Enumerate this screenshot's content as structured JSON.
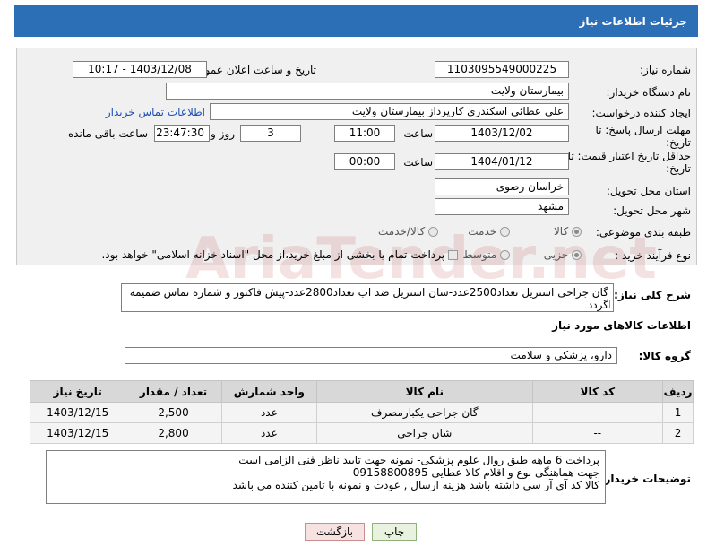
{
  "title": "جزئیات اطلاعات نیاز",
  "fields": {
    "need_number_label": "شماره نیاز:",
    "need_number": "1103095549000225",
    "announce_label": "تاریخ و ساعت اعلان عمومی:",
    "announce_value": "1403/12/08 - 10:17",
    "buyer_org_label": "نام دستگاه خریدار:",
    "buyer_org": "بیمارستان ولایت",
    "requester_label": "ایجاد کننده درخواست:",
    "requester": "علی عطائی اسکندری کارپرداز بیمارستان ولایت",
    "contact_link": "اطلاعات تماس خریدار",
    "deadline_label_1": "مهلت ارسال پاسخ: تا",
    "deadline_label_2": "تاریخ:",
    "deadline_date": "1403/12/02",
    "time_label": "ساعت",
    "deadline_time": "11:00",
    "days": "3",
    "days_label": "روز و",
    "remaining": "23:47:30",
    "remaining_label": "ساعت باقی مانده",
    "validity_label_1": "حداقل تاریخ اعتبار قیمت: تا",
    "validity_label_2": "تاریخ:",
    "validity_date": "1404/01/12",
    "validity_time": "00:00",
    "province_label": "استان محل تحویل:",
    "province": "خراسان رضوی",
    "city_label": "شهر محل تحویل:",
    "city": "مشهد",
    "category_label": "طبقه بندی موضوعی:",
    "category_options": [
      "کالا",
      "خدمت",
      "کالا/خدمت"
    ],
    "process_label": "نوع فرآیند خرید :",
    "process_options": [
      "جزیی",
      "متوسط"
    ],
    "payment_note": "پرداخت تمام یا بخشی از مبلغ خرید،از محل \"اسناد خزانه اسلامی\" خواهد بود."
  },
  "description": {
    "label": "شرح کلی نیاز:",
    "text": "گان جراحی استریل تعداد2500عدد-شان استریل ضد اب تعداد2800عدد-پیش فاکتور و شماره تماس ضمیمه گردد"
  },
  "goods": {
    "section_title": "اطلاعات کالاهای مورد نیاز",
    "group_label": "گروه کالا:",
    "group_value": "دارو، پزشکی و سلامت",
    "columns": [
      "ردیف",
      "کد کالا",
      "نام کالا",
      "واحد شمارش",
      "تعداد / مقدار",
      "تاریخ نیاز"
    ],
    "rows": [
      {
        "row": "1",
        "code": "--",
        "name": "گان جراحی یکبارمصرف",
        "unit": "عدد",
        "qty": "2,500",
        "date": "1403/12/15"
      },
      {
        "row": "2",
        "code": "--",
        "name": "شان جراحی",
        "unit": "عدد",
        "qty": "2,800",
        "date": "1403/12/15"
      }
    ]
  },
  "buyer_notes": {
    "label": "توضیحات خریدار:",
    "text": "پرداخت 6 ماهه طبق روال علوم پزشکی-  نمونه جهت تایید ناظر فنی الزامی است\nجهت هماهنگی نوع و اقلام کالا  عطایی 09158800895-\nکالا کد آی آر سی  داشته باشد هزینه ارسال , عودت و نمونه با تامین کننده می باشد"
  },
  "buttons": {
    "print": "چاپ",
    "back": "بازگشت"
  },
  "watermark": "AriaTender.net"
}
